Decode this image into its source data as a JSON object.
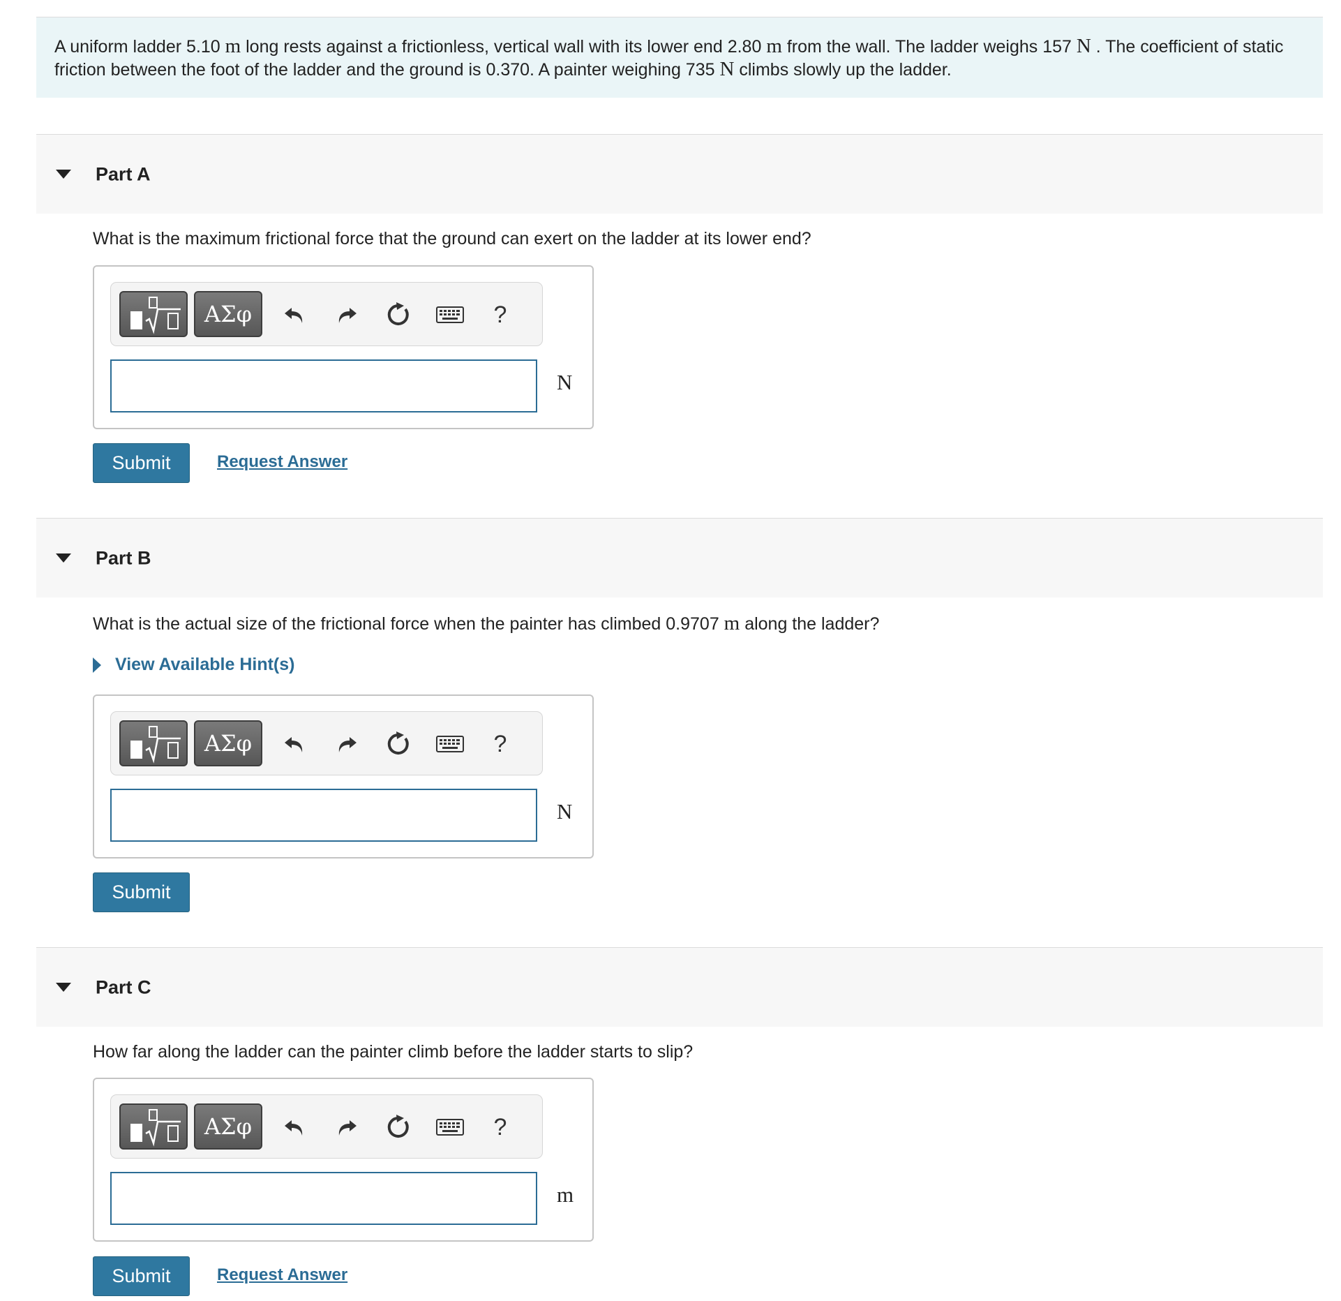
{
  "intro": {
    "t1": "A uniform ladder 5.10",
    "u1": "m",
    "t2": "long rests against a frictionless, vertical wall with its lower end 2.80",
    "u2": "m",
    "t3": "from the wall. The ladder weighs 157",
    "u3": "N",
    "t4": ". The coefficient of static friction between the foot of the ladder and the ground is 0.370.  A painter weighing 735",
    "u4": "N",
    "t5": "climbs slowly up the ladder."
  },
  "toolbar": {
    "greek_label": "ΑΣφ",
    "help_label": "?"
  },
  "parts": [
    {
      "title": "Part A",
      "question": "What is the maximum frictional force that the ground can exert on the ladder at its lower end?",
      "unit": "N",
      "input_value": "",
      "submit_label": "Submit",
      "request_label": "Request Answer"
    },
    {
      "title": "Part B",
      "question_pre": "What is the actual size of the frictional force when the painter has climbed 0.9707",
      "question_unit": "m",
      "question_post": "along the ladder?",
      "hint_label": "View Available Hint(s)",
      "unit": "N",
      "input_value": "",
      "submit_label": "Submit"
    },
    {
      "title": "Part C",
      "question": "How far along the ladder can the painter climb before the ladder starts to slip?",
      "unit": "m",
      "input_value": "",
      "submit_label": "Submit",
      "request_label": "Request Answer"
    }
  ]
}
